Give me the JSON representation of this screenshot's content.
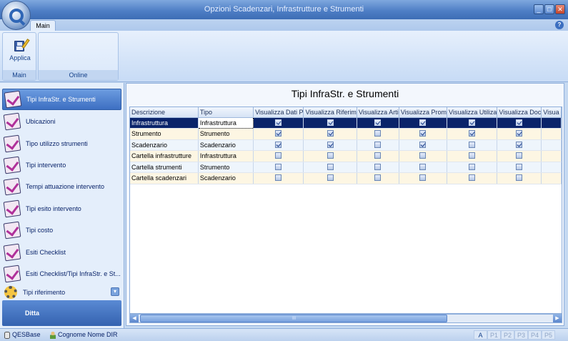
{
  "window": {
    "title": "Opzioni Scadenzari, Infrastrutture e Strumenti"
  },
  "ribbon": {
    "tab": "Main",
    "groups": [
      {
        "label": "Main",
        "button": "Applica"
      },
      {
        "label": "Online"
      }
    ]
  },
  "sidebar": {
    "items": [
      {
        "label": "Tipi InfraStr. e Strumenti",
        "icon": "checklist-icon",
        "selected": true
      },
      {
        "label": "Ubicazioni",
        "icon": "checklist-icon"
      },
      {
        "label": "Tipo utilizzo strumenti",
        "icon": "checklist-icon"
      },
      {
        "label": "Tipi intervento",
        "icon": "checklist-icon"
      },
      {
        "label": "Tempi attuazione intervento",
        "icon": "checklist-icon"
      },
      {
        "label": "Tipi esito intervento",
        "icon": "checklist-icon"
      },
      {
        "label": "Tipi costo",
        "icon": "checklist-icon"
      },
      {
        "label": "Esiti Checklist",
        "icon": "checklist-icon"
      },
      {
        "label": "Esiti Checklist/Tipi InfraStr. e St...",
        "icon": "checklist-icon"
      },
      {
        "label": "Tipi riferimento",
        "icon": "gears-icon"
      }
    ],
    "footer": "Ditta"
  },
  "main": {
    "title": "Tipi InfraStr. e Strumenti",
    "columns": [
      "Descrizione",
      "Tipo",
      "Visualizza Dati P",
      "Visualizza Riferim",
      "Visualizza Arti",
      "Visualizza Prom",
      "Visualizza Utiliza",
      "Visualizza Doc",
      "Visua"
    ],
    "rows": [
      {
        "descrizione": "Infrastruttura",
        "tipo": "Infrastruttura",
        "checks": [
          true,
          true,
          true,
          true,
          true,
          true
        ]
      },
      {
        "descrizione": "Strumento",
        "tipo": "Strumento",
        "checks": [
          true,
          true,
          false,
          true,
          true,
          true
        ]
      },
      {
        "descrizione": "Scadenzario",
        "tipo": "Scadenzario",
        "checks": [
          true,
          true,
          false,
          true,
          false,
          true
        ]
      },
      {
        "descrizione": "Cartella infrastrutture",
        "tipo": "Infrastruttura",
        "checks": [
          false,
          false,
          false,
          false,
          false,
          false
        ]
      },
      {
        "descrizione": "Cartella strumenti",
        "tipo": "Strumento",
        "checks": [
          false,
          false,
          false,
          false,
          false,
          false
        ]
      },
      {
        "descrizione": "Cartella scadenzari",
        "tipo": "Scadenzario",
        "checks": [
          false,
          false,
          false,
          false,
          false,
          false
        ]
      }
    ],
    "scroll_grip": "III"
  },
  "status": {
    "db": "QESBase",
    "user": "Cognome Nome DIR",
    "panels": [
      "A",
      "P1",
      "P2",
      "P3",
      "P4",
      "P5"
    ]
  },
  "colors": {
    "accent": "#3d6fc2",
    "title_bar": "#4f7fc6",
    "selected_row": "#0a246a"
  }
}
